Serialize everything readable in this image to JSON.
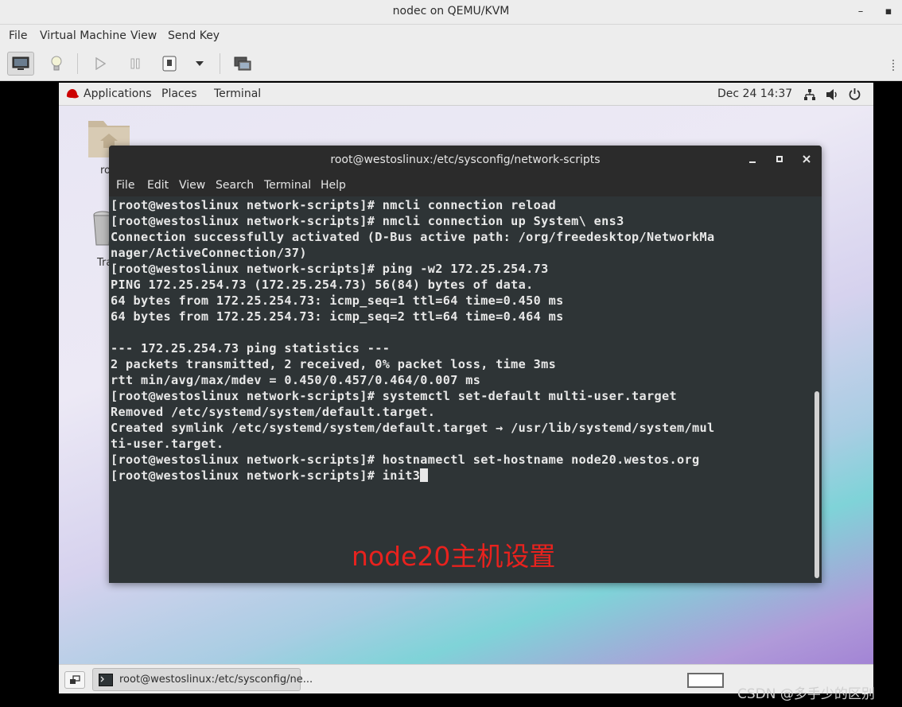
{
  "host": {
    "title": "nodec on QEMU/KVM",
    "minimize": "–",
    "close": "▪",
    "menu": [
      "File",
      "Virtual Machine",
      "View",
      "Send Key"
    ]
  },
  "panel": {
    "applications": "Applications",
    "places": "Places",
    "terminal": "Terminal",
    "clock": "Dec 24  14:37"
  },
  "desktop": {
    "home_label": "ro",
    "trash_label": "Tra"
  },
  "terminal": {
    "title": "root@westoslinux:/etc/sysconfig/network-scripts",
    "menu": [
      "File",
      "Edit",
      "View",
      "Search",
      "Terminal",
      "Help"
    ],
    "lines": [
      "[root@westoslinux network-scripts]# nmcli connection reload",
      "[root@westoslinux network-scripts]# nmcli connection up System\\ ens3",
      "Connection successfully activated (D-Bus active path: /org/freedesktop/NetworkMa",
      "nager/ActiveConnection/37)",
      "[root@westoslinux network-scripts]# ping -w2 172.25.254.73",
      "PING 172.25.254.73 (172.25.254.73) 56(84) bytes of data.",
      "64 bytes from 172.25.254.73: icmp_seq=1 ttl=64 time=0.450 ms",
      "64 bytes from 172.25.254.73: icmp_seq=2 ttl=64 time=0.464 ms",
      "",
      "--- 172.25.254.73 ping statistics ---",
      "2 packets transmitted, 2 received, 0% packet loss, time 3ms",
      "rtt min/avg/max/mdev = 0.450/0.457/0.464/0.007 ms",
      "[root@westoslinux network-scripts]# systemctl set-default multi-user.target",
      "Removed /etc/systemd/system/default.target.",
      "Created symlink /etc/systemd/system/default.target → /usr/lib/systemd/system/mul",
      "ti-user.target.",
      "[root@westoslinux network-scripts]# hostnamectl set-hostname node20.westos.org"
    ],
    "current_input": "[root@westoslinux network-scripts]# init3"
  },
  "caption": "node20主机设置",
  "taskbar": {
    "window_label": "root@westoslinux:/etc/sysconfig/ne..."
  },
  "watermark": "CSDN @多手少的区别",
  "colors": {
    "terminal_bg": "#2e3436",
    "terminal_fg": "#e8e8e8",
    "caption": "#e8221e",
    "redhat_red": "#cc0000"
  }
}
